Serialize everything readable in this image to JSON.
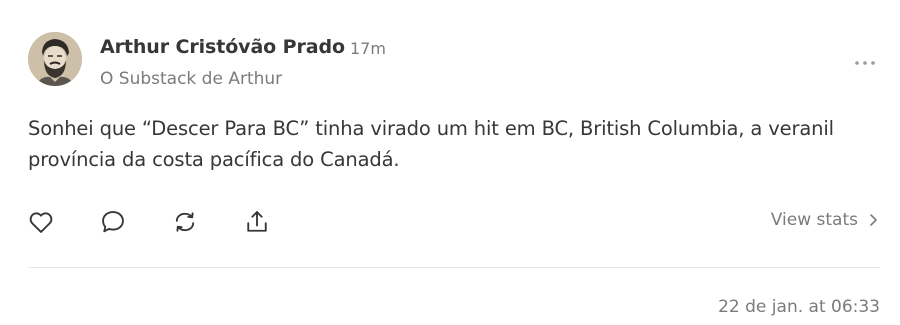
{
  "note": {
    "author": {
      "name": "Arthur Cristóvão Prado",
      "publication": "O Substack de Arthur",
      "avatar_icon": "bearded-man-portrait"
    },
    "time_ago": "17m",
    "more_icon": "ellipsis-icon",
    "body": "Sonhei que “Descer Para BC” tinha virado um hit em BC, British Columbia, a veranil província da costa pacífica do Canadá.",
    "actions": [
      {
        "name": "like",
        "icon": "heart-icon"
      },
      {
        "name": "comment",
        "icon": "comment-icon"
      },
      {
        "name": "restack",
        "icon": "restack-icon"
      },
      {
        "name": "share",
        "icon": "share-icon"
      }
    ],
    "view_stats_label": "View stats",
    "date": "22 de jan. at 06:33"
  },
  "colors": {
    "text": "#363737",
    "muted": "#7b7b7b",
    "divider": "#e6e6e6",
    "background": "#ffffff"
  }
}
